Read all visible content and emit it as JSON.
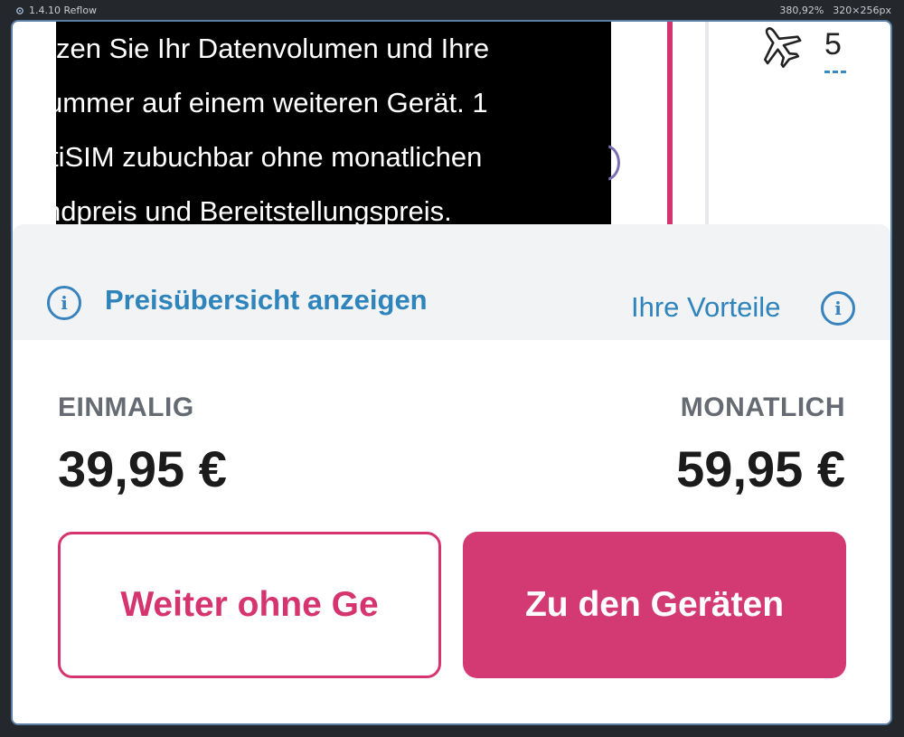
{
  "topbar": {
    "version": "1.4.10 Reflow",
    "zoom": "380,92%",
    "viewport": "320×256px"
  },
  "background": {
    "overlay_lines": [
      "zen Sie Ihr Datenvolumen und Ihre",
      "ummer auf einem weiteren Gerät. 1",
      "tiSIM zubuchbar ohne monatlichen",
      "ndpreis und Bereitstellungspreis."
    ],
    "plane_count": "5"
  },
  "info_bar": {
    "price_overview_label": "Preisübersicht anzeigen",
    "benefits_label": "Ihre Vorteile"
  },
  "pricing": {
    "once_label": "EINMALIG",
    "once_value": "39,95 €",
    "monthly_label": "MONATLICH",
    "monthly_value": "59,95 €"
  },
  "actions": {
    "continue_label": "Weiter ohne Ge",
    "devices_label": "Zu den Geräten"
  },
  "colors": {
    "magenta": "#d5346e",
    "link_blue": "#2e84bb"
  }
}
